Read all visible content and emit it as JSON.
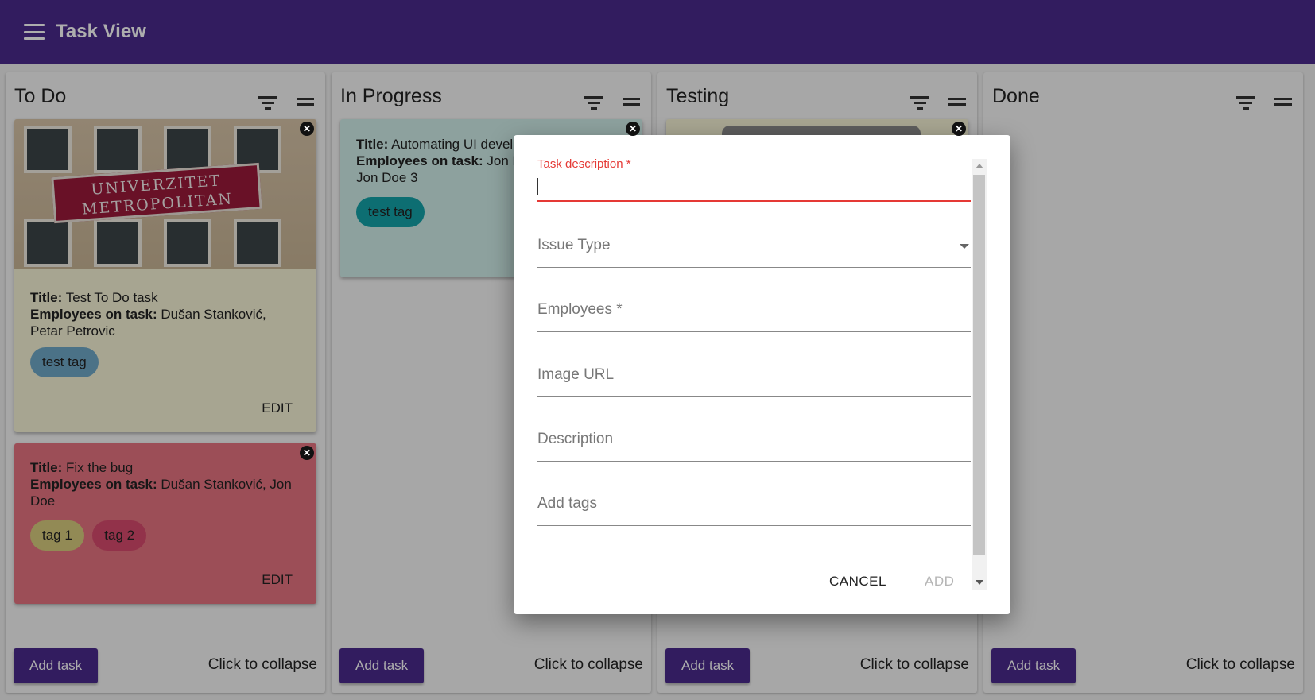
{
  "app": {
    "title": "Task View"
  },
  "colors": {
    "primary": "#4a2a8c",
    "error": "#e53935"
  },
  "labels": {
    "title": "Title:",
    "employees": "Employees on task:"
  },
  "columns": [
    {
      "title": "To Do",
      "add_label": "Add task",
      "collapse_label": "Click to collapse"
    },
    {
      "title": "In Progress",
      "add_label": "Add task",
      "collapse_label": "Click to collapse"
    },
    {
      "title": "Testing",
      "add_label": "Add task",
      "collapse_label": "Click to collapse"
    },
    {
      "title": "Done",
      "add_label": "Add task",
      "collapse_label": "Click to collapse"
    }
  ],
  "cards": {
    "todo_1": {
      "image_text_line1": "UNIVERZITET",
      "image_text_line2": "METROPOLITAN",
      "title": "Test To Do task",
      "employees": "Dušan Stanković, Petar Petrovic",
      "tags": [
        "test tag"
      ],
      "tag_colors": [
        "#6fa8c8"
      ],
      "edit_label": "EDIT",
      "background": "#f6f3d6"
    },
    "todo_2": {
      "title": "Fix the bug",
      "employees": "Dušan Stanković, Jon Doe",
      "tags": [
        "tag 1",
        "tag 2"
      ],
      "tag_colors": [
        "#d8cc7e",
        "#d84a6e"
      ],
      "edit_label": "EDIT",
      "background": "#e67480"
    },
    "inprogress_1": {
      "title": "Automating UI devel",
      "employees": "Jon D",
      "employees_line2": "Jon Doe 3",
      "tags": [
        "test tag"
      ],
      "tag_colors": [
        "#14a3a8"
      ],
      "background": "#d0ede9"
    }
  },
  "dialog": {
    "fields": {
      "task_description": "Task description *",
      "issue_type": "Issue Type",
      "employees": "Employees *",
      "image_url": "Image URL",
      "description": "Description",
      "add_tags": "Add tags"
    },
    "cancel_label": "CANCEL",
    "add_label": "ADD"
  },
  "icons": [
    "menu-icon",
    "filter-icon",
    "collapse-icon",
    "close-icon",
    "dropdown-arrow-icon"
  ]
}
